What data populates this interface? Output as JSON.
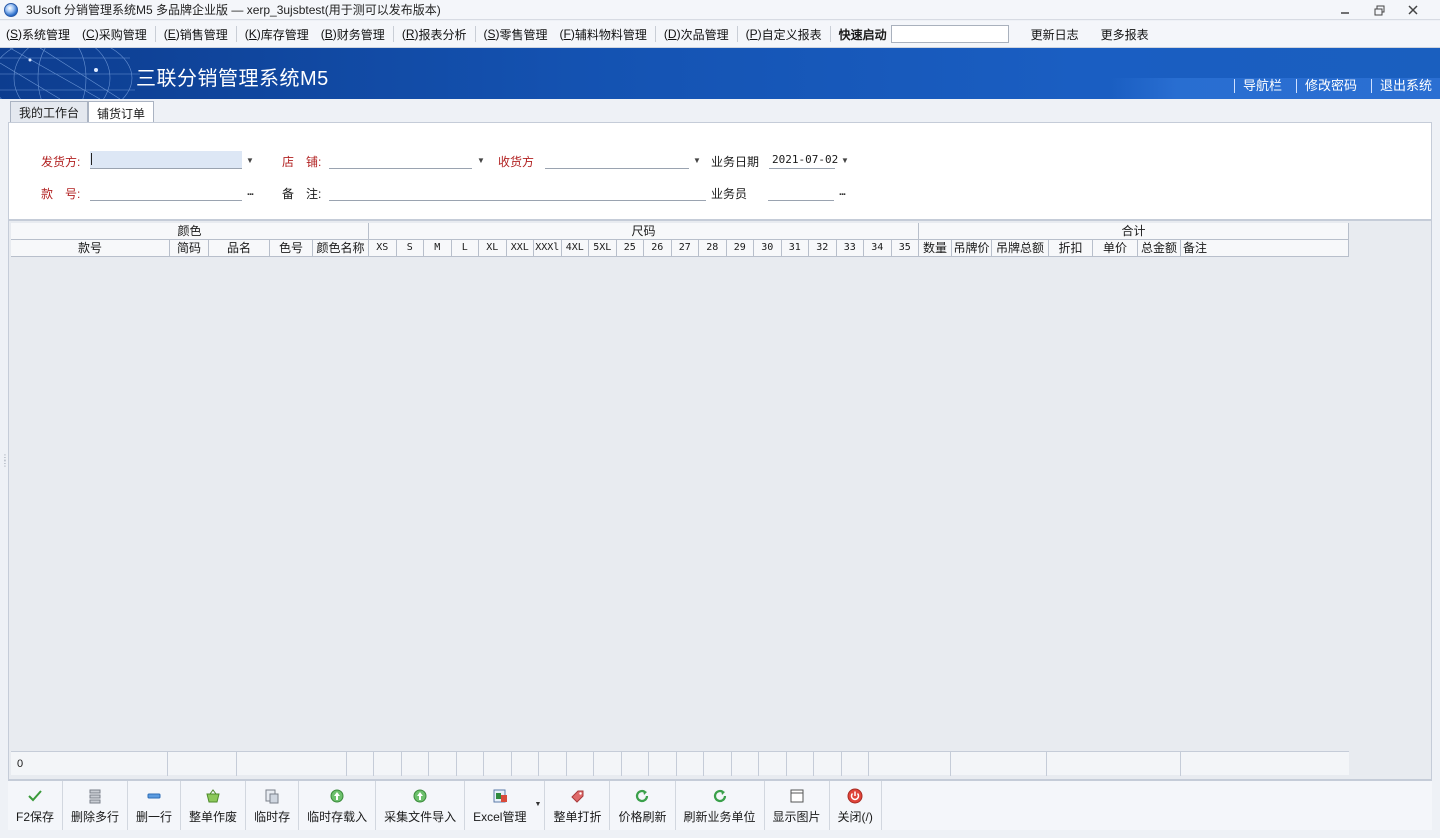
{
  "window": {
    "title": "3Usoft 分销管理系统M5 多品牌企业版 — xerp_3ujsbtest(用于测可以发布版本)",
    "controls": [
      "minimize-icon",
      "restore-icon",
      "close-icon"
    ]
  },
  "menu": {
    "items": [
      {
        "key": "S",
        "label": "系统管理"
      },
      {
        "key": "C",
        "label": "采购管理"
      },
      {
        "key": "E",
        "label": "销售管理"
      },
      {
        "key": "K",
        "label": "库存管理"
      },
      {
        "key": "B",
        "label": "财务管理"
      },
      {
        "key": "R",
        "label": "报表分析"
      },
      {
        "key": "S",
        "label": "零售管理"
      },
      {
        "key": "F",
        "label": "辅料物料管理"
      },
      {
        "key": "D",
        "label": "次品管理"
      },
      {
        "key": "P",
        "label": "自定义报表"
      }
    ],
    "quick_start_label": "快速启动",
    "quick_start_value": "",
    "update_log": "更新日志",
    "more_reports": "更多报表"
  },
  "banner": {
    "title": "三联分销管理系统M5",
    "links": [
      "导航栏",
      "修改密码",
      "退出系统"
    ]
  },
  "tabs": [
    {
      "label": "我的工作台",
      "active": false
    },
    {
      "label": "铺货订单",
      "active": true
    }
  ],
  "form": {
    "shipper_label": "发货方:",
    "shipper_value": "",
    "store_label": "店　铺:",
    "store_value": "",
    "receiver_label": "收货方",
    "receiver_value": "",
    "biz_date_label": "业务日期",
    "biz_date_value": "2021-07-02",
    "style_no_label": "款　号:",
    "style_no_value": "",
    "remark_label": "备　注:",
    "remark_value": "",
    "salesman_label": "业务员",
    "salesman_value": "",
    "ellipsis": "..."
  },
  "grid": {
    "groups": {
      "color": "颜色",
      "size": "尺码",
      "total": "合计"
    },
    "columns": {
      "style_no": "款号",
      "short_code": "简码",
      "product_name": "品名",
      "color_no": "色号",
      "color_name": "颜色名称",
      "sizes": [
        "XS",
        "S",
        "M",
        "L",
        "XL",
        "XXL",
        "XXXl",
        "4XL",
        "5XL",
        "25",
        "26",
        "27",
        "28",
        "29",
        "30",
        "31",
        "32",
        "33",
        "34",
        "35"
      ],
      "qty": "数量",
      "tag_price": "吊牌价",
      "tag_total": "吊牌总额",
      "discount": "折扣",
      "unit_price": "单价",
      "total_amount": "总金额",
      "note": "备注"
    },
    "footer_count": "0"
  },
  "toolbar": [
    {
      "label": "F2保存",
      "icon": "check-icon"
    },
    {
      "label": "删除多行",
      "icon": "delete-rows-icon"
    },
    {
      "label": "删一行",
      "icon": "minus-icon"
    },
    {
      "label": "整单作废",
      "icon": "basket-icon"
    },
    {
      "label": "临时存",
      "icon": "temp-save-icon"
    },
    {
      "label": "临时存载入",
      "icon": "load-icon"
    },
    {
      "label": "采集文件导入",
      "icon": "import-icon"
    },
    {
      "label": "Excel管理",
      "icon": "excel-icon"
    },
    {
      "label": "整单打折",
      "icon": "tag-icon"
    },
    {
      "label": "价格刷新",
      "icon": "refresh-icon"
    },
    {
      "label": "刷新业务单位",
      "icon": "refresh-units-icon"
    },
    {
      "label": "显示图片",
      "icon": "picture-icon"
    },
    {
      "label": "关闭(/)",
      "icon": "power-icon"
    }
  ],
  "colors": {
    "banner_dark": "#0d3d8f",
    "banner_light": "#1a5fbf",
    "field_label_red": "#b22222",
    "focus_field": "#dde7f5"
  }
}
